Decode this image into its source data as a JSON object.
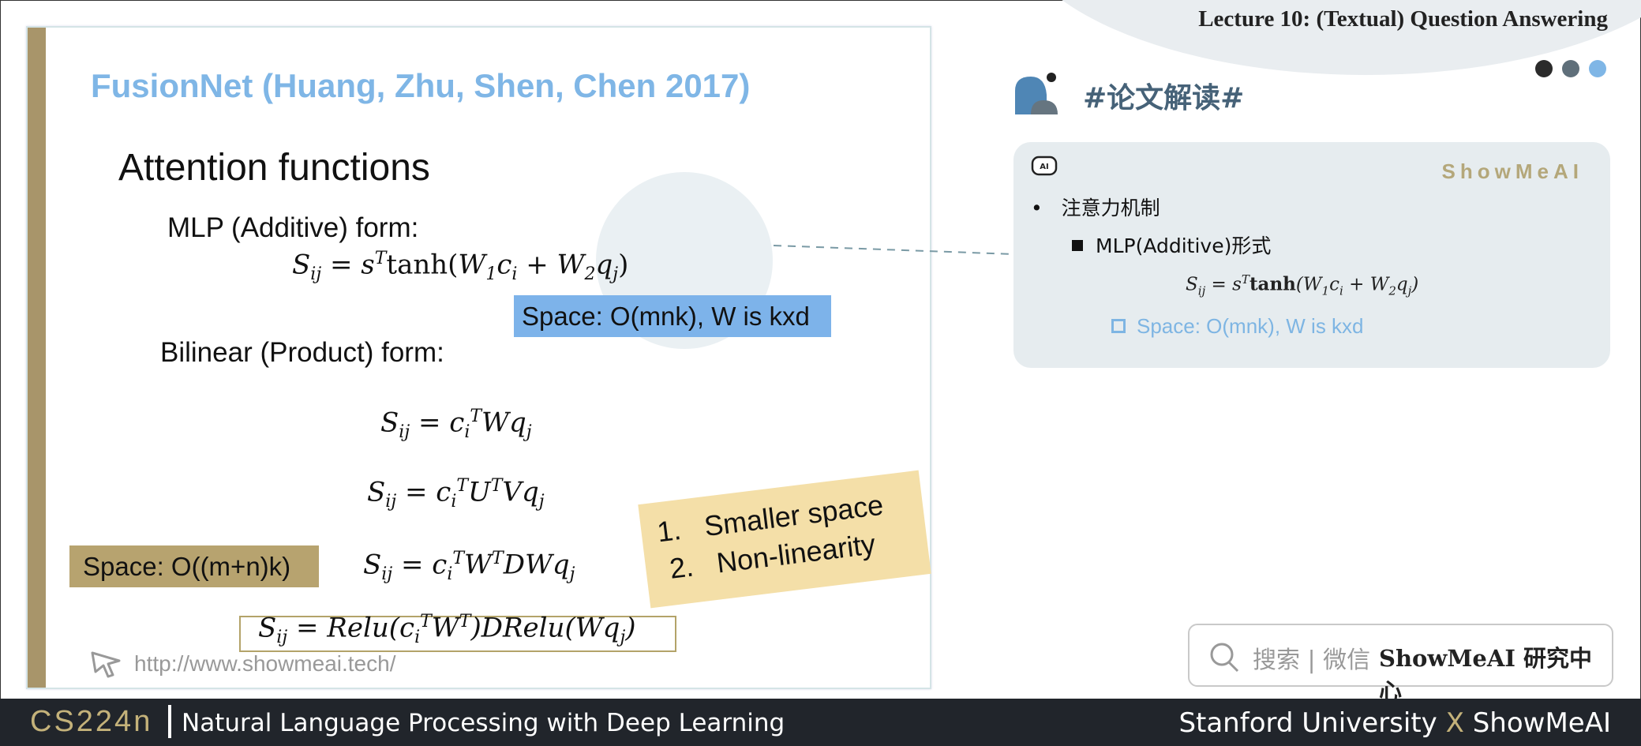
{
  "header": {
    "lecture_title": "Lecture 10: (Textual) Question Answering",
    "dot_colors": [
      "#2b2b2b",
      "#5f6f7a",
      "#7fb6e6"
    ]
  },
  "slide": {
    "title": "FusionNet (Huang, Zhu, Shen, Chen 2017)",
    "heading": "Attention functions",
    "mlp_label": "MLP (Additive) form:",
    "space_blue": "Space: O(mnk), W is kxd",
    "bilinear_label": "Bilinear (Product) form:",
    "space_gold": "Space: O((m+n)k)",
    "note_item1_num": "1.",
    "note_item1": "Smaller space",
    "note_item2_num": "2.",
    "note_item2": "Non-linearity",
    "url": "http://www.showmeai.tech/"
  },
  "right_panel": {
    "tag": "#论文解读#",
    "brand": "ShowMeAI",
    "bullet1": "注意力机制",
    "bullet2": "MLP(Additive)形式",
    "bullet3": "Space: O(mnk), W is kxd"
  },
  "search": {
    "hint": "搜索 | 微信",
    "name": "ShowMeAI 研究中心"
  },
  "footer": {
    "course_code": "CS224n",
    "course_name": "Natural Language Processing with Deep Learning",
    "university": "Stanford University",
    "x": "X",
    "partner": "ShowMeAI"
  },
  "colors": {
    "accent_blue": "#7fb6e6",
    "accent_gold": "#b7a36f",
    "note_yellow": "#f4dfa8",
    "footer_bg": "#21252b"
  }
}
